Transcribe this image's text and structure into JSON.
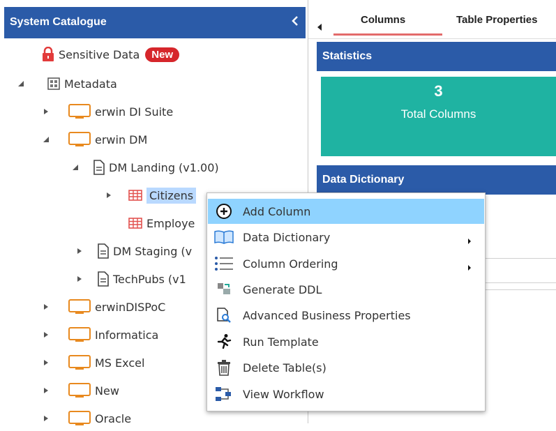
{
  "catalogue": {
    "title": "System Catalogue",
    "items": [
      {
        "label": "Sensitive Data",
        "badge": "New"
      },
      {
        "label": "Metadata"
      },
      {
        "label": "erwin DI Suite"
      },
      {
        "label": "erwin DM"
      },
      {
        "label": "DM Landing (v1.00)"
      },
      {
        "label": "Citizens"
      },
      {
        "label": "Employe"
      },
      {
        "label": "DM Staging (v"
      },
      {
        "label": "TechPubs (v1"
      },
      {
        "label": "erwinDISPoC"
      },
      {
        "label": "Informatica"
      },
      {
        "label": "MS Excel"
      },
      {
        "label": "New"
      },
      {
        "label": "Oracle"
      }
    ]
  },
  "tabs": [
    "Columns",
    "Table Properties"
  ],
  "statistics": {
    "title": "Statistics",
    "count": "3",
    "label": "Total Columns"
  },
  "dictionary": {
    "title": "Data Dictionary"
  },
  "context_menu": [
    {
      "label": "Add Column",
      "icon": "add-circle-icon"
    },
    {
      "label": "Data Dictionary",
      "icon": "book-icon",
      "submenu": true
    },
    {
      "label": "Column Ordering",
      "icon": "list-order-icon",
      "submenu": true
    },
    {
      "label": "Generate DDL",
      "icon": "ddl-icon"
    },
    {
      "label": "Advanced Business Properties",
      "icon": "doc-search-icon"
    },
    {
      "label": "Run Template",
      "icon": "run-icon"
    },
    {
      "label": "Delete Table(s)",
      "icon": "trash-icon"
    },
    {
      "label": "View Workflow",
      "icon": "workflow-icon"
    }
  ],
  "colors": {
    "header": "#2b5ba8",
    "stat": "#1fb3a2",
    "badge": "#d6262b",
    "highlight": "#8fd3ff",
    "selected": "#b9d9ff",
    "folder": "#e8891e",
    "table": "#e2524f"
  }
}
